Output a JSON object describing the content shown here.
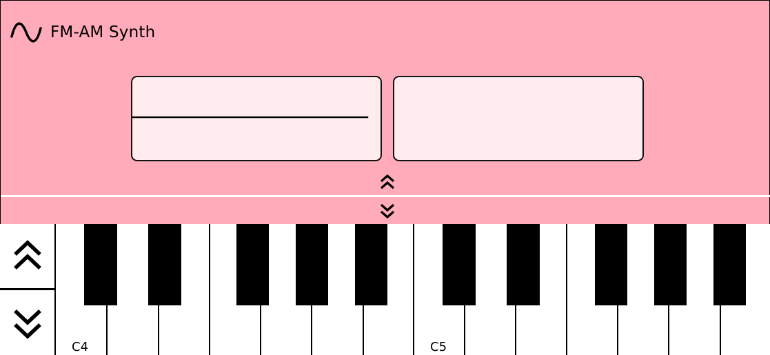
{
  "app": {
    "title": "FM-AM Synth",
    "icon": "sine-wave-icon"
  },
  "colors": {
    "panel_background": "#ffabb9",
    "scope_background": "#ffecee",
    "divider": "#ffffff",
    "keys_white": "#ffffff",
    "keys_black": "#000000"
  },
  "scopes": [
    {
      "name": "waveform-scope",
      "shows_flat_line": true
    },
    {
      "name": "spectrum-scope",
      "shows_flat_line": false
    }
  ],
  "panel_controls": {
    "collapse_up_icon": "double-chevron-up-icon",
    "collapse_down_icon": "double-chevron-down-icon"
  },
  "octave_controls": {
    "up_icon": "double-chevron-up-icon",
    "down_icon": "double-chevron-down-icon"
  },
  "keyboard": {
    "labels": {
      "c4": "C4",
      "c5": "C5"
    }
  }
}
